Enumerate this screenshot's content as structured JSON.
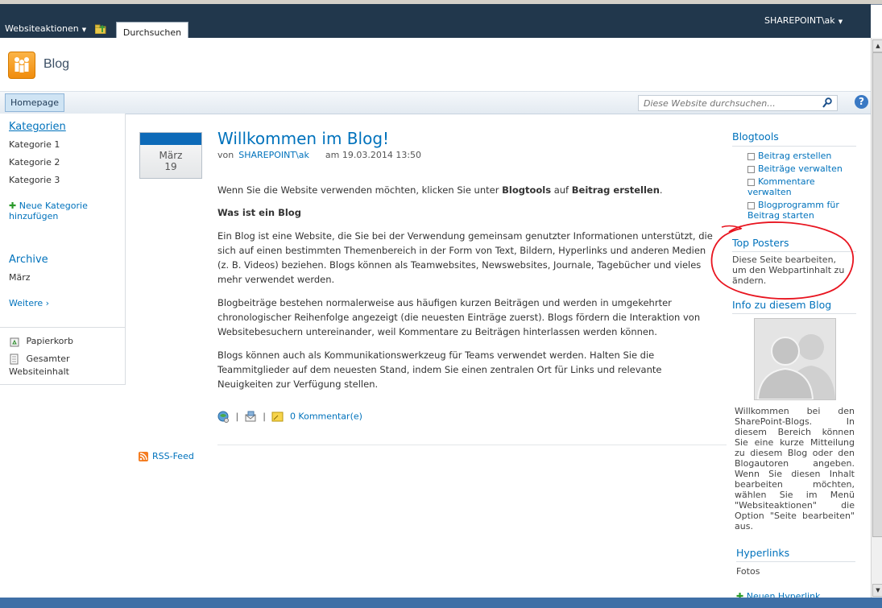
{
  "ribbon": {
    "site_actions": "Websiteaktionen",
    "browse_tab": "Durchsuchen",
    "user": "SHAREPOINT\\ak"
  },
  "site": {
    "title": "Blog"
  },
  "topnav": {
    "home": "Homepage",
    "search_placeholder": "Diese Website durchsuchen..."
  },
  "leftnav": {
    "categories_header": "Kategorien",
    "categories": [
      "Kategorie 1",
      "Kategorie 2",
      "Kategorie 3"
    ],
    "new_category": "Neue Kategorie hinzufügen",
    "archive_header": "Archive",
    "archive_items": [
      "März"
    ],
    "more": "Weitere ›",
    "recycle_bin": "Papierkorb",
    "all_content": "Gesamter Websiteinhalt"
  },
  "post": {
    "month": "März",
    "day": "19",
    "title": "Willkommen im Blog!",
    "by": "von",
    "author": "SHAREPOINT\\ak",
    "date": "am 19.03.2014 13:50",
    "intro_a": "Wenn Sie die Website verwenden möchten, klicken Sie unter ",
    "intro_b": "Blogtools",
    "intro_c": " auf ",
    "intro_d": "Beitrag erstellen",
    "intro_e": ".",
    "heading": "Was ist ein Blog",
    "p1": "Ein Blog ist eine Website, die Sie bei der Verwendung gemeinsam genutzter Informationen unterstützt, die sich auf einen bestimmten Themenbereich in der Form von Text, Bildern, Hyperlinks und anderen Medien (z. B. Videos) beziehen. Blogs können als Teamwebsites, Newswebsites, Journale, Tagebücher und vieles mehr verwendet werden.",
    "p2": "Blogbeiträge bestehen normalerweise aus häufigen kurzen Beiträgen und werden in umgekehrter chronologischer Reihenfolge angezeigt (die neuesten Einträge zuerst). Blogs fördern die Interaktion von Websitebesuchern untereinander, weil Kommentare zu Beiträgen hinterlassen werden können.",
    "p3": "Blogs können auch als Kommunikationswerkzeug für Teams verwendet werden. Halten Sie die Teammitglieder auf dem neuesten Stand, indem Sie einen zentralen Ort für Links und relevante Neuigkeiten zur Verfügung stellen.",
    "separator": "|",
    "comments": "0 Kommentar(e)"
  },
  "rss": "RSS-Feed",
  "right": {
    "blogtools_header": "Blogtools",
    "tools": [
      "Beitrag erstellen",
      "Beiträge verwalten",
      "Kommentare verwalten",
      "Blogprogramm für Beitrag starten"
    ],
    "top_posters_header": "Top Posters",
    "top_posters_text": "Diese Seite bearbeiten, um den Webpartinhalt zu ändern.",
    "about_header": "Info zu diesem Blog",
    "about_text": "Willkommen bei den SharePoint-Blogs. In diesem Bereich können Sie eine kurze Mitteilung zu diesem Blog oder den Blogautoren angeben. Wenn Sie diesen Inhalt bearbeiten möchten, wählen Sie im Menü \"Websiteaktionen\" die Option \"Seite bearbeiten\" aus.",
    "hyperlinks_header": "Hyperlinks",
    "hyperlinks": [
      "Fotos"
    ],
    "new_hyperlink": "Neuen Hyperlink"
  },
  "colors": {
    "ribbon": "#21374c",
    "link": "#0072bc",
    "annotation": "#e8141f"
  }
}
